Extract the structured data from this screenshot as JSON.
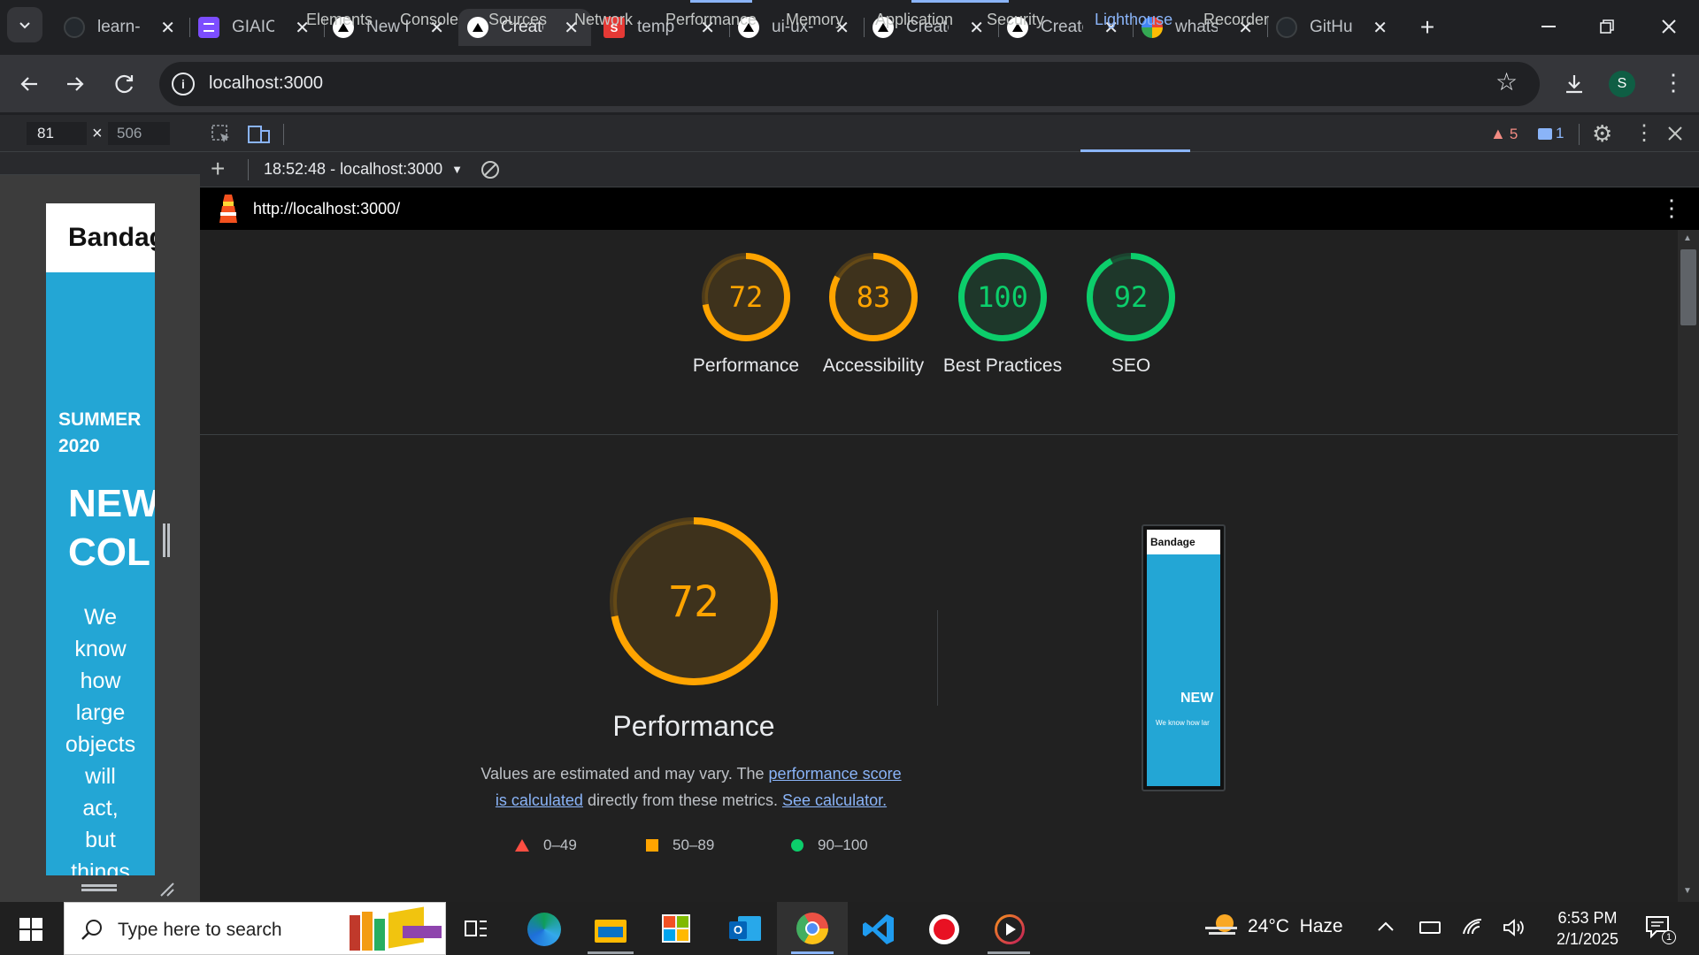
{
  "browser": {
    "tabs": [
      {
        "title": "learn-",
        "icon": "github-icon",
        "color": "#24292e"
      },
      {
        "title": "GIAIC",
        "icon": "purple-app-icon",
        "color": "#7c4dff"
      },
      {
        "title": "New I",
        "icon": "vercel-icon",
        "color": "#000000"
      },
      {
        "title": "Create",
        "icon": "vercel-icon",
        "color": "#000000"
      },
      {
        "title": "temp",
        "icon": "s-logo-icon",
        "color": "#e53935"
      },
      {
        "title": "ui-ux-",
        "icon": "vercel-icon",
        "color": "#000000"
      },
      {
        "title": "Create",
        "icon": "vercel-icon",
        "color": "#000000"
      },
      {
        "title": "Create",
        "icon": "vercel-icon",
        "color": "#000000"
      },
      {
        "title": "whats",
        "icon": "google-icon",
        "color": "#ffffff"
      },
      {
        "title": "GitHu",
        "icon": "github-icon",
        "color": "#24292e"
      }
    ],
    "address": "localhost:3000",
    "profile_initial": "S"
  },
  "devtools": {
    "width_value": "81",
    "height_value": "506",
    "tabs": [
      "Elements",
      "Console",
      "Sources",
      "Network",
      "Performance",
      "Memory",
      "Application",
      "Security",
      "Lighthouse",
      "Recorder"
    ],
    "active_tab": "Lighthouse",
    "warnings_count": "5",
    "messages_count": "1",
    "report_selector": "18:52:48 - localhost:3000",
    "report_url": "http://localhost:3000/"
  },
  "preview": {
    "brand": "Bandag",
    "season": "SUMMER 2020",
    "headline_1": "NEW",
    "headline_2": "COL",
    "body_words": [
      "We",
      "know",
      "how",
      "large",
      "objects",
      "will",
      "act,",
      "but",
      "things"
    ]
  },
  "lighthouse": {
    "scores": [
      {
        "value": "72",
        "label": "Performance",
        "status": "average"
      },
      {
        "value": "83",
        "label": "Accessibility",
        "status": "average"
      },
      {
        "value": "100",
        "label": "Best Practices",
        "status": "pass"
      },
      {
        "value": "92",
        "label": "SEO",
        "status": "pass"
      }
    ],
    "main_score": "72",
    "main_label": "Performance",
    "desc_1": "Values are estimated and may vary. The ",
    "desc_link_1": "performance score is calculated",
    "desc_2": " directly from these metrics. ",
    "desc_link_2": "See calculator.",
    "legend": [
      {
        "range": "0–49",
        "shape": "triangle",
        "color": "#ff4e42"
      },
      {
        "range": "50–89",
        "shape": "square",
        "color": "#ffa400"
      },
      {
        "range": "90–100",
        "shape": "circle",
        "color": "#0cce6b"
      }
    ],
    "thumb_brand": "Bandage",
    "thumb_headline": "NEW",
    "thumb_body": "We know how lar"
  },
  "taskbar": {
    "search_placeholder": "Type here to search",
    "weather": "24°C  Haze",
    "time": "6:53 PM",
    "date": "2/1/2025",
    "notifications": "1"
  },
  "colors": {
    "average": "#ffa400",
    "pass": "#0cce6b",
    "fail": "#ff4e42",
    "accent": "#8ab4f8"
  }
}
